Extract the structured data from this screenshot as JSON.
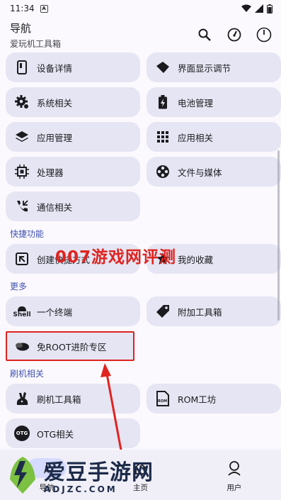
{
  "status_bar": {
    "time": "11:34",
    "notification_badge": "A",
    "battery_icon": "battery-icon"
  },
  "app_bar": {
    "title": "导航",
    "subtitle": "爱玩机工具箱"
  },
  "main": {
    "rows": [
      [
        {
          "label": "设备详情",
          "icon": "phone-icon"
        },
        {
          "label": "界面显示调节",
          "icon": "display-icon"
        }
      ],
      [
        {
          "label": "系统相关",
          "icon": "gear-icon"
        },
        {
          "label": "电池管理",
          "icon": "battery-icon"
        }
      ],
      [
        {
          "label": "应用管理",
          "icon": "layers-icon"
        },
        {
          "label": "应用相关",
          "icon": "apps-grid-icon"
        }
      ],
      [
        {
          "label": "处理器",
          "icon": "cpu-icon"
        },
        {
          "label": "文件与媒体",
          "icon": "film-reel-icon"
        }
      ],
      [
        {
          "label": "通信相关",
          "icon": "phone-call-icon"
        }
      ]
    ],
    "section_shortcuts": "快捷功能",
    "shortcuts": [
      {
        "label": "创建快捷方式",
        "icon": "shortcut-icon"
      },
      {
        "label": "我的收藏",
        "icon": "star-icon"
      }
    ],
    "section_more": "更多",
    "more": [
      {
        "label": "一个终端",
        "icon": "shell-icon"
      },
      {
        "label": "附加工具箱",
        "icon": "tag-icon"
      }
    ],
    "root_free": {
      "label": "免ROOT进阶专区",
      "icon": "stone-icon"
    },
    "section_flash": "刷机相关",
    "flash": [
      {
        "label": "刷机工具箱",
        "icon": "rabbit-icon"
      },
      {
        "label": "ROM工坊",
        "icon": "rom-file-icon"
      }
    ],
    "otg": {
      "label": "OTG相关",
      "icon": "otg-icon",
      "icon_text": "OTG"
    },
    "shell_icon_text": "Shell",
    "rom_icon_text": "ROM"
  },
  "overlay_text": "007游戏网评测",
  "bottom_nav": [
    {
      "label": "导航",
      "active": true
    },
    {
      "label": "主页",
      "active": false
    },
    {
      "label": "用户",
      "active": false
    }
  ],
  "watermark": {
    "title": "爱豆手游网",
    "sub": "ADJZC.COM"
  },
  "colors": {
    "accent": "#4152b0",
    "card": "#e5e5f3",
    "annotation": "#e0231f"
  }
}
